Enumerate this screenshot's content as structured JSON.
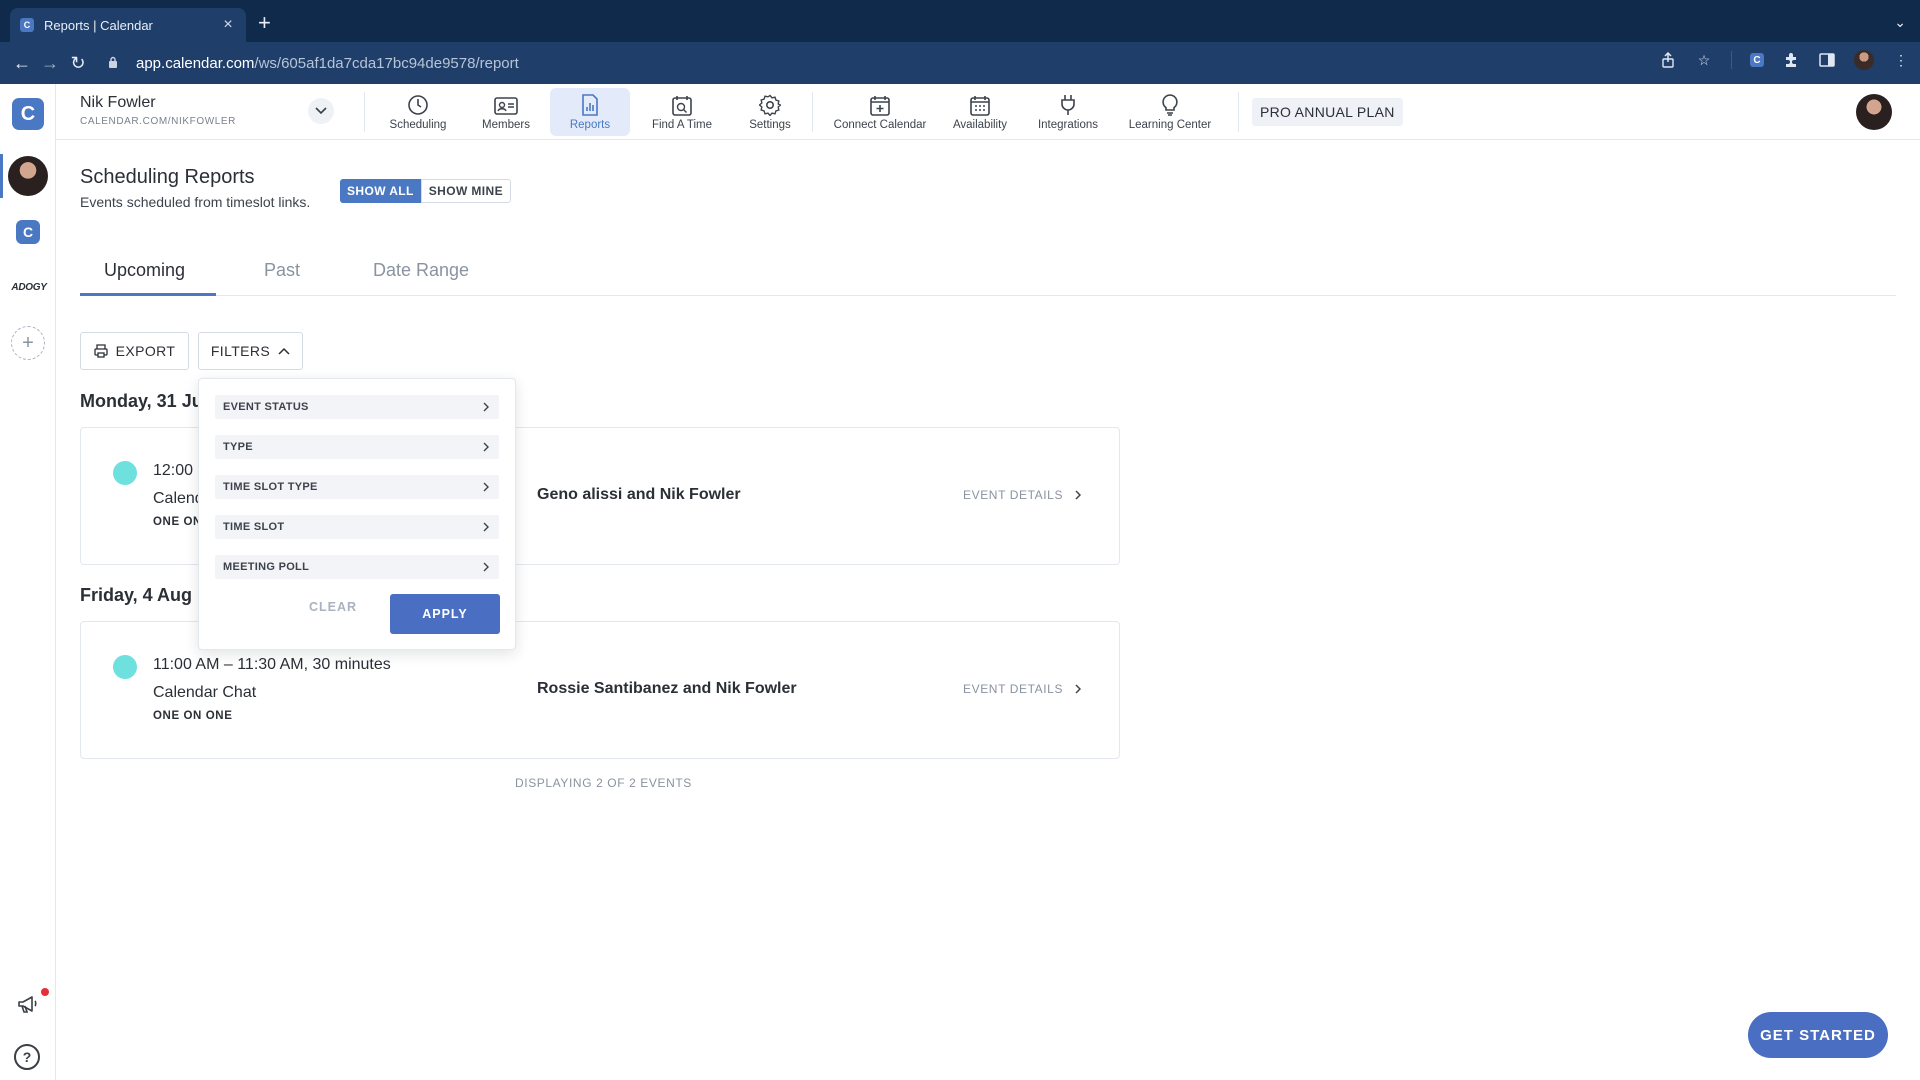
{
  "browser": {
    "tab_title": "Reports | Calendar",
    "favicon_letter": "C",
    "new_tab": "+",
    "close_tab": "×",
    "url_host": "app.calendar.com",
    "url_path": "/ws/605af1da7cda17bc94de9578/report"
  },
  "rail": {
    "logo_letter": "C",
    "workspace_c": "C",
    "workspace_adogy": "ADOGY",
    "add": "+",
    "help": "?"
  },
  "appnav": {
    "user_name": "Nik Fowler",
    "user_url": "CALENDAR.COM/NIKFOWLER",
    "items": [
      {
        "label": "Scheduling",
        "icon": "clock-icon"
      },
      {
        "label": "Members",
        "icon": "id-card-icon"
      },
      {
        "label": "Reports",
        "icon": "report-icon"
      },
      {
        "label": "Find A Time",
        "icon": "calendar-search-icon"
      },
      {
        "label": "Settings",
        "icon": "gear-icon"
      },
      {
        "label": "Connect Calendar",
        "icon": "calendar-plus-icon"
      },
      {
        "label": "Availability",
        "icon": "calendar-grid-icon"
      },
      {
        "label": "Integrations",
        "icon": "plug-icon"
      },
      {
        "label": "Learning Center",
        "icon": "lightbulb-icon"
      }
    ],
    "active_item": "Reports",
    "plan": "PRO ANNUAL PLAN"
  },
  "page": {
    "title": "Scheduling Reports",
    "subtitle": "Events scheduled from timeslot links.",
    "show_all": "SHOW ALL",
    "show_mine": "SHOW MINE",
    "tabs": [
      "Upcoming",
      "Past",
      "Date Range"
    ],
    "active_tab": "Upcoming",
    "export": "EXPORT",
    "filters": "FILTERS"
  },
  "days": [
    {
      "heading": "Monday, 31 Ju",
      "event": {
        "time": "12:00",
        "name": "Calend",
        "type": "ONE ON",
        "people": "Geno alissi and Nik Fowler",
        "link": "EVENT DETAILS"
      }
    },
    {
      "heading": "Friday, 4 Aug",
      "event": {
        "time": "11:00 AM – 11:30 AM, 30 minutes",
        "name": "Calendar Chat",
        "type": "ONE ON ONE",
        "people": "Rossie Santibanez and Nik Fowler",
        "link": "EVENT DETAILS"
      }
    }
  ],
  "display_count": "DISPLAYING 2 OF 2 EVENTS",
  "filter_panel": {
    "rows": [
      "EVENT STATUS",
      "TYPE",
      "TIME SLOT TYPE",
      "TIME SLOT",
      "MEETING POLL"
    ],
    "clear": "CLEAR",
    "apply": "APPLY"
  },
  "cta": "GET STARTED",
  "colors": {
    "accent": "#4a78c2",
    "event_dot": "#6ee0de",
    "browser_bg": "#102a4c",
    "notification": "#e5303a"
  }
}
